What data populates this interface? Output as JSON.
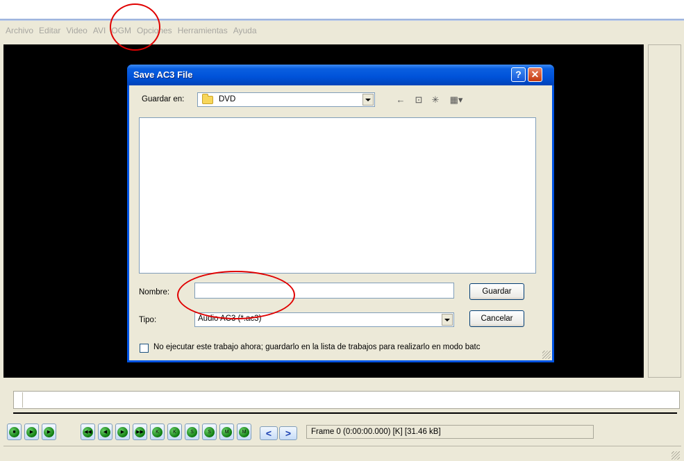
{
  "menu": [
    "Archivo",
    "Editar",
    "Video",
    "AVI",
    "OGM",
    "Opciones",
    "Herramientas",
    "Ayuda"
  ],
  "dialog": {
    "title": "Save AC3 File",
    "help_glyph": "?",
    "close_glyph": "✕",
    "save_in_label": "Guardar en:",
    "save_in_value": "DVD",
    "name_label": "Nombre:",
    "name_value": "",
    "type_label": "Tipo:",
    "type_value": "Audio AC3 (*.ac3)",
    "save_button": "Guardar",
    "cancel_button": "Cancelar",
    "batch_checkbox_label": "No ejecutar este trabajo ahora; guardarlo en la lista de trabajos para realizarlo en modo batc",
    "batch_checked": false,
    "toolbar_icons": [
      "back-arrow-icon",
      "up-folder-icon",
      "new-folder-icon",
      "view-menu-icon"
    ]
  },
  "controls": {
    "playback_buttons": [
      "stop",
      "play",
      "play-audio",
      "start",
      "prev-frame",
      "next-frame",
      "end",
      "prev-key",
      "next-key",
      "prev-scene",
      "next-scene",
      "prev-marker"
    ],
    "mark_in": "<",
    "mark_out": ">"
  },
  "status": {
    "frame_text": "Frame 0 (0:00:00.000) [K] [31.46 kB]"
  },
  "colors": {
    "annotation": "#e00000",
    "title_bar": "#0054e3"
  }
}
